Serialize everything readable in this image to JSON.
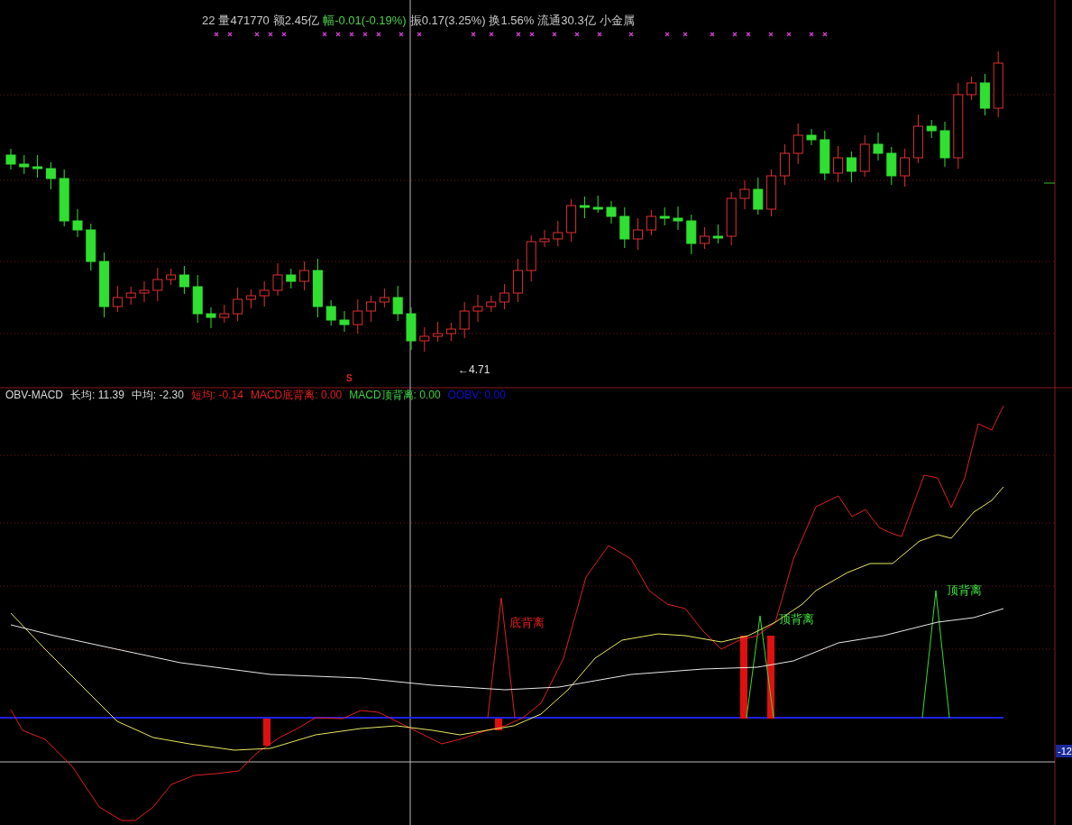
{
  "quote_bar": [
    {
      "text": "22",
      "kind": "plain"
    },
    {
      "text": "量471770",
      "kind": "plain"
    },
    {
      "text": "额2.45亿",
      "kind": "plain"
    },
    {
      "text": "幅-0.01(-0.19%)",
      "kind": "down"
    },
    {
      "text": "振0.17(3.25%)",
      "kind": "plain"
    },
    {
      "text": "换1.56%",
      "kind": "plain"
    },
    {
      "text": "流通30.3亿",
      "kind": "plain"
    },
    {
      "text": "小金属",
      "kind": "plain"
    }
  ],
  "price_chart": {
    "low_marker": "←4.71",
    "signal_mark": "S"
  },
  "indicator": {
    "legend": [
      {
        "text": "OBV-MACD",
        "color": "#d8d8d8"
      },
      {
        "text": "长均: 11.39",
        "color": "#d8d8d8"
      },
      {
        "text": "中均: -2.30",
        "color": "#d8d8d8"
      },
      {
        "text": "短均: -0.14",
        "color": "#e02020"
      },
      {
        "text": "MACD底背离: 0.00",
        "color": "#e02020"
      },
      {
        "text": "MACD顶背离: 0.00",
        "color": "#40d040"
      },
      {
        "text": "OOBV: 0.00",
        "color": "#1010d0"
      }
    ],
    "annotations": [
      {
        "text": "底背离",
        "kind": "bottom"
      },
      {
        "text": "顶背离",
        "kind": "top"
      },
      {
        "text": "顶背离",
        "kind": "top"
      }
    ],
    "axis_readout": "-12"
  }
}
